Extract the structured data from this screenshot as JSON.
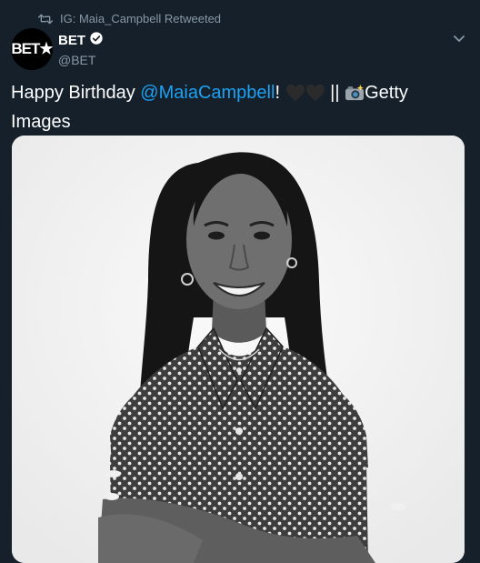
{
  "retweet": {
    "label": "IG: Maia_Campbell Retweeted"
  },
  "author": {
    "display_name": "BET",
    "handle": "@BET",
    "avatar_text": "BET★"
  },
  "tweet": {
    "text_before": "Happy Birthday ",
    "mention": "@MaiaCampbell",
    "text_after_mention": "! ",
    "text_middle": " || ",
    "text_end": "Getty Images"
  },
  "icons": {
    "retweet": "retweet-icon",
    "verified": "verified-badge-icon",
    "caret": "chevron-down-icon",
    "heart": "black-heart-icon",
    "camera": "camera-flash-icon"
  },
  "colors": {
    "background": "#15202b",
    "text_secondary": "#8899a6",
    "link": "#1da1f2"
  }
}
